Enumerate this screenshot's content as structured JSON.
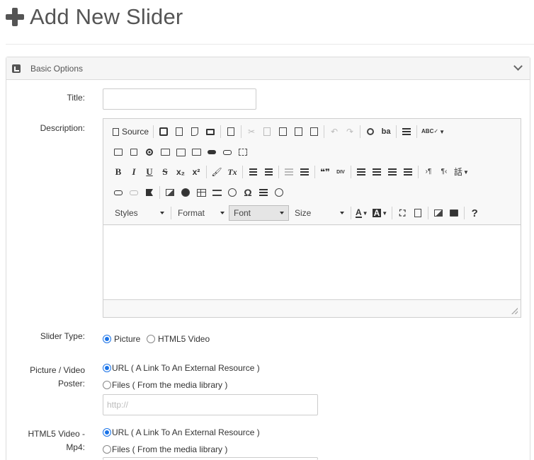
{
  "page": {
    "title": "Add New Slider"
  },
  "panel": {
    "heading": "Basic Options"
  },
  "form": {
    "title_label": "Title:",
    "title_value": "",
    "description_label": "Description:",
    "slider_type_label": "Slider Type:",
    "slider_type_options": [
      "Picture",
      "HTML5 Video"
    ],
    "slider_type_selected": "Picture",
    "poster_label_line1": "Picture / Video",
    "poster_label_line2": "Poster:",
    "poster_options": [
      "URL ( A Link To An External Resource )",
      "Files ( From the media library )"
    ],
    "poster_selected": "URL ( A Link To An External Resource )",
    "poster_url_placeholder": "http://",
    "mp4_label_line1": "HTML5 Video -",
    "mp4_label_line2": "Mp4:",
    "mp4_options": [
      "URL ( A Link To An External Resource )",
      "Files ( From the media library )"
    ],
    "mp4_selected": "URL ( A Link To An External Resource )"
  },
  "editor": {
    "source_label": "Source",
    "combos": {
      "styles": "Styles",
      "format": "Format",
      "font": "Font",
      "size": "Size"
    },
    "symbols": {
      "bold": "B",
      "italic": "I",
      "underline": "U",
      "strike": "S",
      "subscript": "x₂",
      "superscript": "x²",
      "remove_format": "Tx",
      "ordered_list": "⒈",
      "bullet_list": "•",
      "blockquote": "❝❞",
      "div": "DIV",
      "ltr": "›¶",
      "rtl": "¶‹",
      "language": "話",
      "omega": "Ω",
      "help": "?",
      "undo": "↶",
      "redo": "↷",
      "find": "🔍",
      "spellcheck": "ABC✓",
      "maximize": "⛶"
    }
  },
  "colors": {
    "accent": "#1a73e8",
    "title_text": "#555555",
    "panel_bg": "#f5f5f5",
    "toolbar_bg": "#f8f8f8"
  }
}
